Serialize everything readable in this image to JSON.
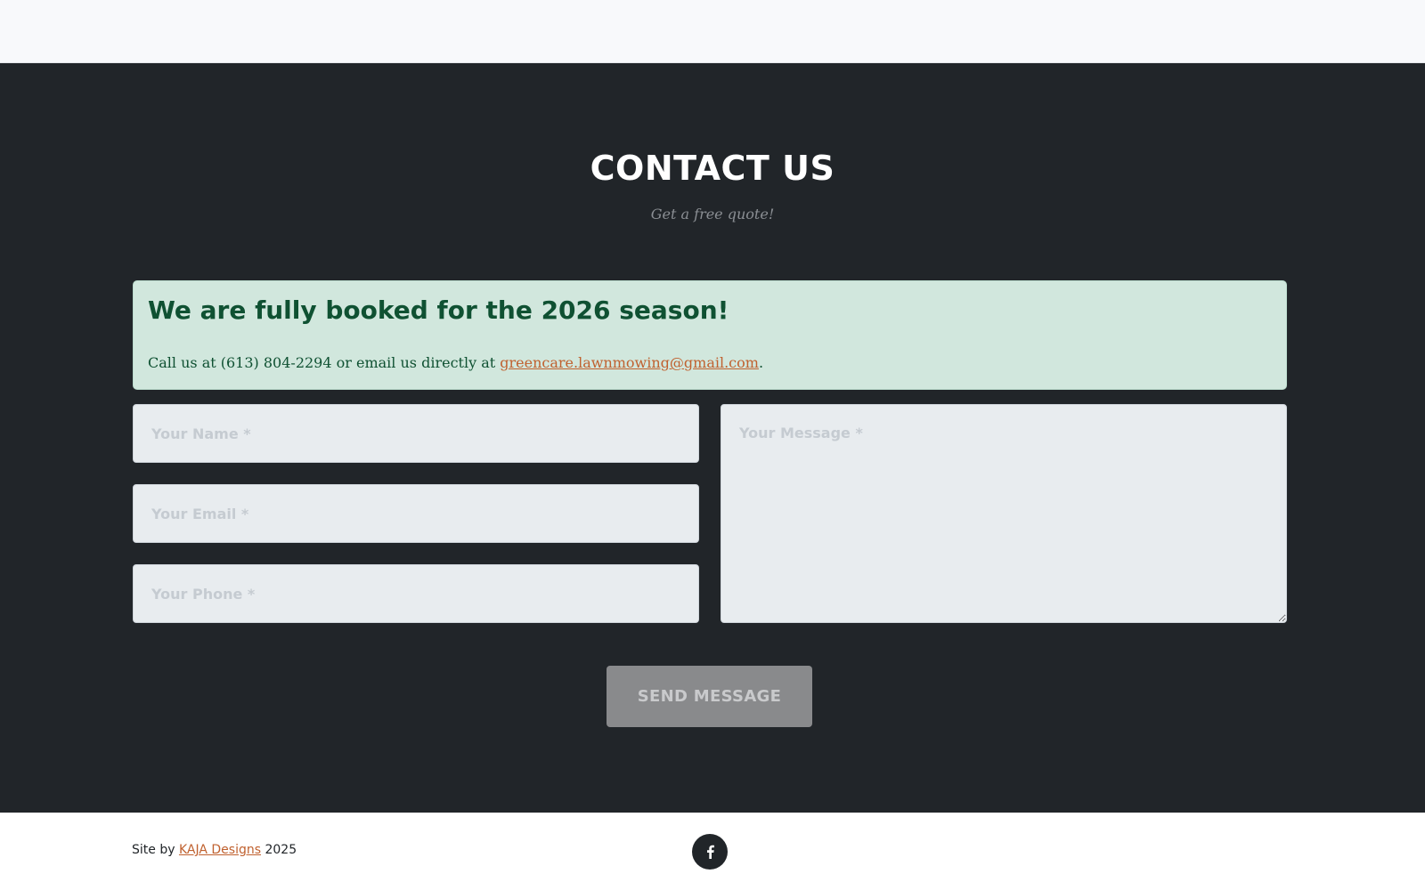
{
  "contact": {
    "title": "CONTACT US",
    "subtitle": "Get a free quote!"
  },
  "alert": {
    "heading": "We are fully booked for the 2026 season!",
    "text_before": "Call us at (613) 804-2294 or email us directly at ",
    "email": "greencare.lawnmowing@gmail.com",
    "text_after": "."
  },
  "form": {
    "name_placeholder": "Your Name *",
    "email_placeholder": "Your Email *",
    "phone_placeholder": "Your Phone *",
    "message_placeholder": "Your Message *",
    "send_label": "SEND MESSAGE"
  },
  "footer": {
    "prefix": "Site by ",
    "credit_link": "KAJA Designs",
    "year": " 2025",
    "social_icon": "facebook-icon"
  },
  "colors": {
    "dark_bg": "#212529",
    "alert_bg": "#d1e7dd",
    "alert_text": "#0f5132",
    "link": "#c0612f",
    "button_bg": "#898a8c"
  }
}
